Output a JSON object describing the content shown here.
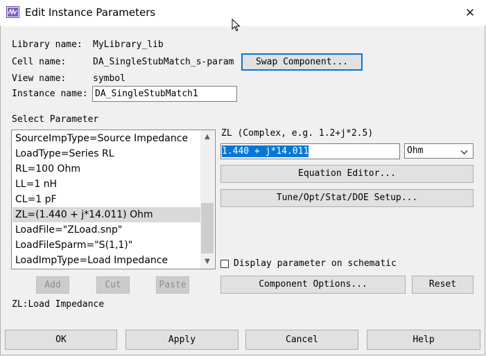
{
  "window": {
    "title": "Edit Instance Parameters",
    "close_glyph": "✕"
  },
  "info": {
    "library_label": "Library name:",
    "library_value": "MyLibrary_lib",
    "cell_label": "Cell name:",
    "cell_value": "DA_SingleStubMatch_s-param",
    "view_label": "View name:",
    "view_value": "symbol",
    "instance_label": "Instance name:",
    "instance_value": "DA_SingleStubMatch1"
  },
  "swap_button": "Swap Component...",
  "select_parameter_label": "Select Parameter",
  "parameters": [
    "SourceImpType=Source Impedance",
    "LoadType=Series RL",
    "RL=100 Ohm",
    "LL=1 nH",
    "CL=1 pF",
    "ZL=(1.440 + j*14.011) Ohm",
    "LoadFile=\"ZLoad.snp\"",
    "LoadFileSparm=\"S(1,1)\"",
    "LoadImpType=Load Impedance"
  ],
  "selected_index": 5,
  "param_editor": {
    "label": "ZL (Complex, e.g. 1.2+j*2.5)",
    "value": "1.440 + j*14.011",
    "unit": "Ohm",
    "equation_editor": "Equation Editor...",
    "tune_setup": "Tune/Opt/Stat/DOE Setup..."
  },
  "display_on_schematic": {
    "label": "Display parameter on schematic",
    "checked": false
  },
  "list_buttons": {
    "add": "Add",
    "cut": "Cut",
    "paste": "Paste"
  },
  "component_options": "Component Options...",
  "reset": "Reset",
  "description": "ZL:Load Impedance",
  "footer": {
    "ok": "OK",
    "apply": "Apply",
    "cancel": "Cancel",
    "help": "Help"
  },
  "icons": {
    "app": "app-icon",
    "close": "close-icon",
    "scroll_up": "scroll-up-icon",
    "scroll_down": "scroll-down-icon",
    "dropdown": "chevron-down-icon",
    "cursor": "mouse-cursor-icon"
  },
  "colors": {
    "selection_highlight": "#0078d7",
    "list_selected": "#d9d9d9",
    "focus_border": "#0078d7"
  }
}
